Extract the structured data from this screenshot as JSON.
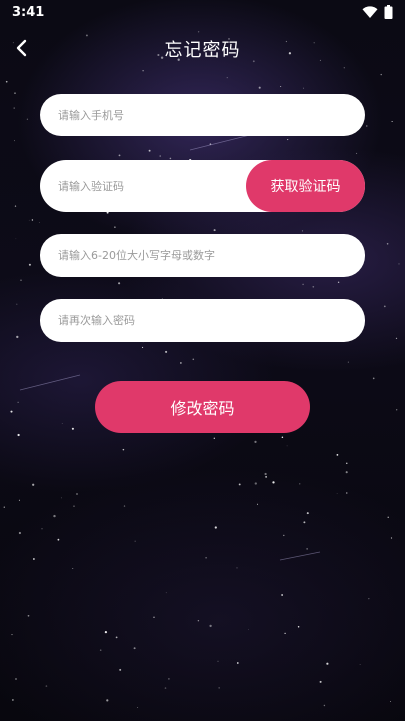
{
  "status_bar": {
    "time": "3:41",
    "icons": [
      "wifi-icon",
      "battery-icon"
    ]
  },
  "header": {
    "title": "忘记密码",
    "back_icon": "chevron-left-icon"
  },
  "form": {
    "phone": {
      "value": "",
      "placeholder": "请输入手机号"
    },
    "code": {
      "value": "",
      "placeholder": "请输入验证码",
      "button_label": "获取验证码"
    },
    "password": {
      "value": "",
      "placeholder": "请输入6-20位大小写字母或数字"
    },
    "confirm_password": {
      "value": "",
      "placeholder": "请再次输入密码"
    },
    "submit_label": "修改密码"
  },
  "colors": {
    "accent": "#e0396a",
    "field_background": "#ffffff",
    "placeholder": "#9a9a9a",
    "background": "#0b0a14"
  }
}
